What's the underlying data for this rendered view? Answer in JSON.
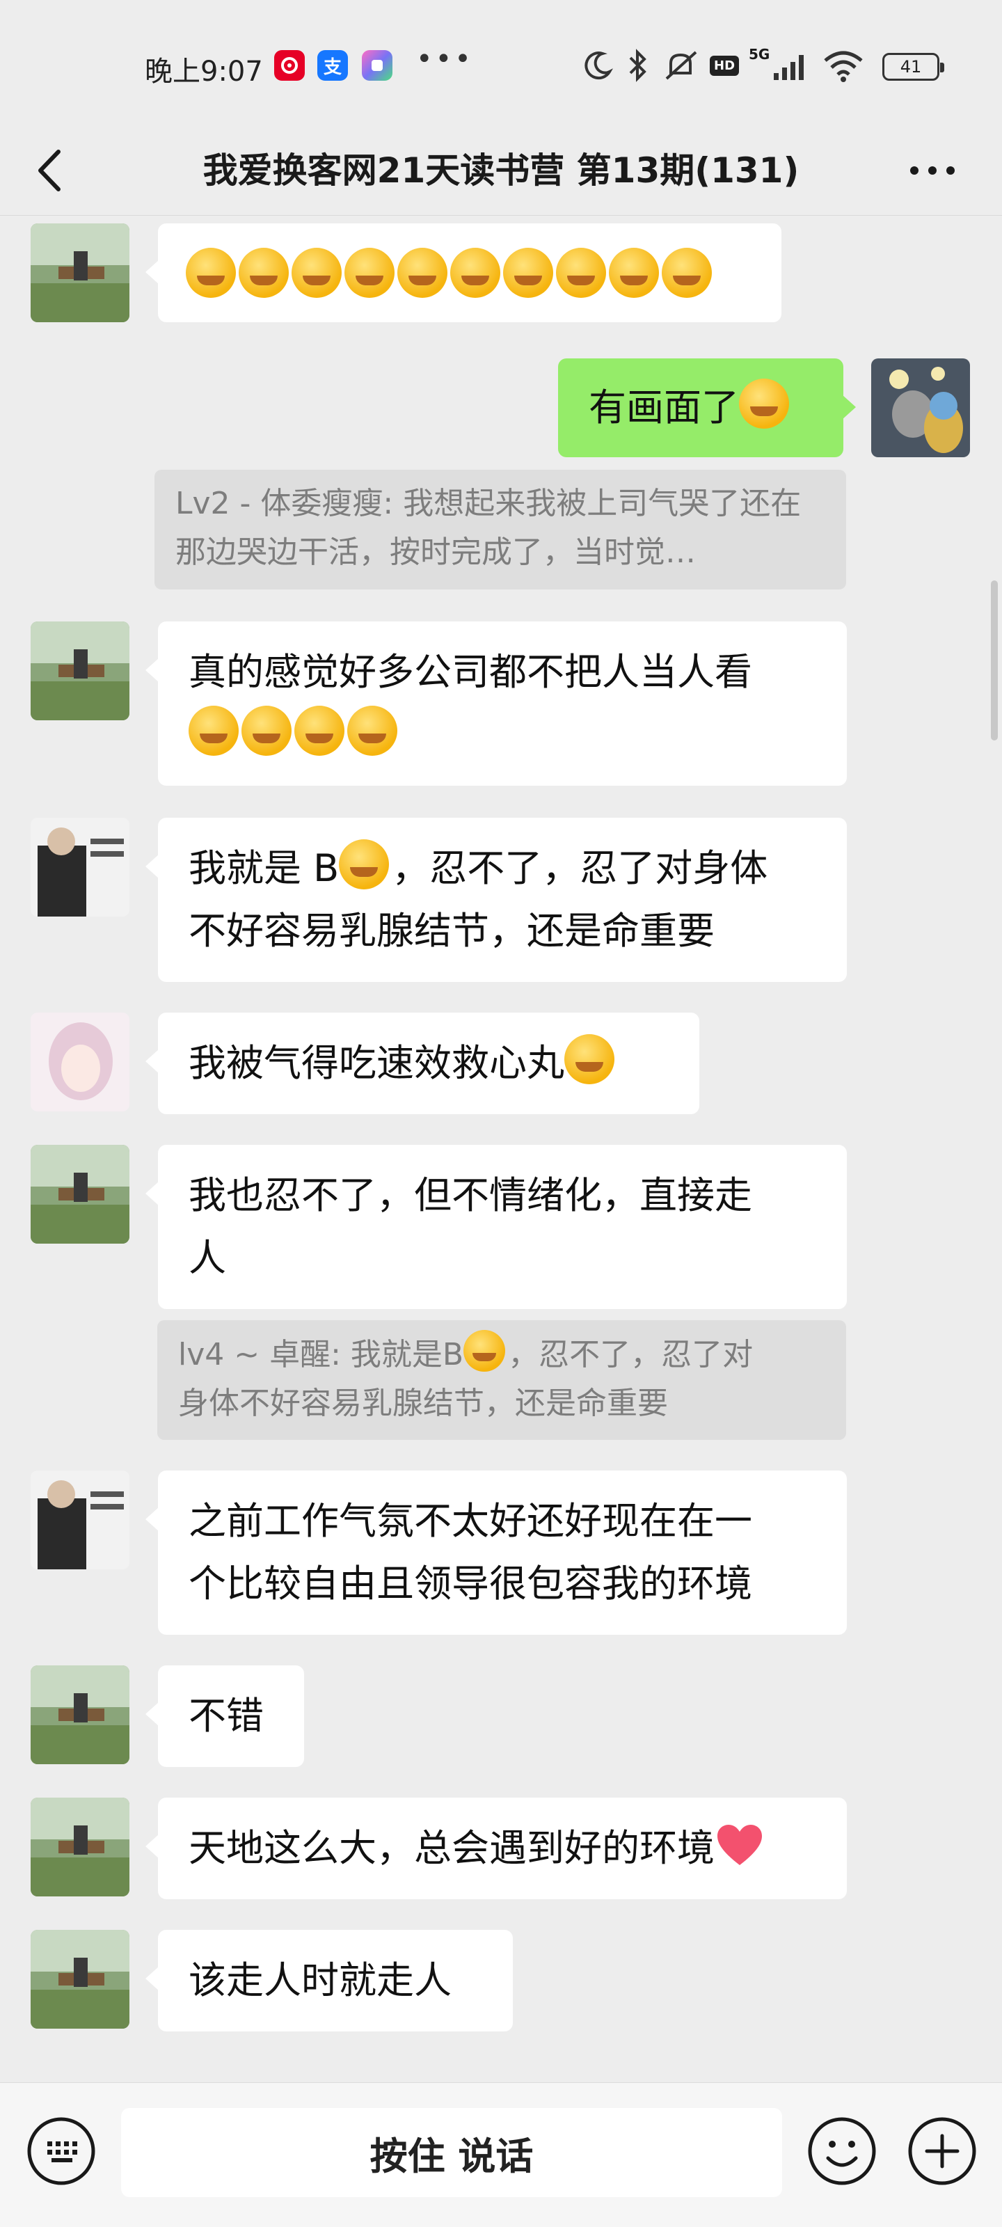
{
  "status_bar": {
    "time": "晚上9:07",
    "app_icons": [
      "netease-music-icon",
      "alipay-icon",
      "app-icon",
      "more-dots"
    ],
    "network": "5G",
    "hd": "HD",
    "battery": "41"
  },
  "header": {
    "title": "我爱换客网21天读书营 第13期(131)"
  },
  "messages": [
    {
      "side": "left",
      "avatar": "landscape-avatar",
      "text": "",
      "emoji_count": 10
    },
    {
      "side": "right",
      "avatar": "cat-photo-avatar",
      "text": "有画面了"
    },
    {
      "quote": "Lv2 - 体委瘦瘦: 我想起来我被上司气哭了还在那边哭边干活，按时完成了，当时觉…"
    },
    {
      "side": "left",
      "avatar": "landscape-avatar",
      "text_line1": "真的感觉好多公司都不把人当人看",
      "emoji_count": 4
    },
    {
      "side": "left",
      "avatar": "portrait-avatar",
      "text_part1": "我就是 B",
      "text_part2": "，忍不了，忍了对身体",
      "text_line2": "不好容易乳腺结节，还是命重要"
    },
    {
      "side": "left",
      "avatar": "anime-girl-avatar",
      "text": "我被气得吃速效救心丸"
    },
    {
      "side": "left",
      "avatar": "landscape-avatar",
      "text_line1": "我也忍不了，但不情绪化，直接走",
      "text_line2": "人"
    },
    {
      "quote_line1_part1": "lv4 ~ 卓醒: 我就是B",
      "quote_line1_part2": "，忍不了，忍了对",
      "quote_line2": "身体不好容易乳腺结节，还是命重要"
    },
    {
      "side": "left",
      "avatar": "portrait-avatar",
      "text_line1": "之前工作气氛不太好还好现在在一",
      "text_line2": "个比较自由且领导很包容我的环境"
    },
    {
      "side": "left",
      "avatar": "landscape-avatar",
      "text": "不错"
    },
    {
      "side": "left",
      "avatar": "landscape-avatar",
      "text": "天地这么大，总会遇到好的环境"
    },
    {
      "side": "left",
      "avatar": "landscape-avatar",
      "text": "该走人时就走人"
    }
  ],
  "input_bar": {
    "hold_to_talk": "按住 说话",
    "left_icon": "keyboard-icon",
    "emoji_icon": "emoji-icon",
    "plus_icon": "plus-icon"
  },
  "colors": {
    "background": "#ededed",
    "bubble_mine": "#95ec69",
    "bubble_other": "#ffffff",
    "quote_bg": "#dedede"
  }
}
